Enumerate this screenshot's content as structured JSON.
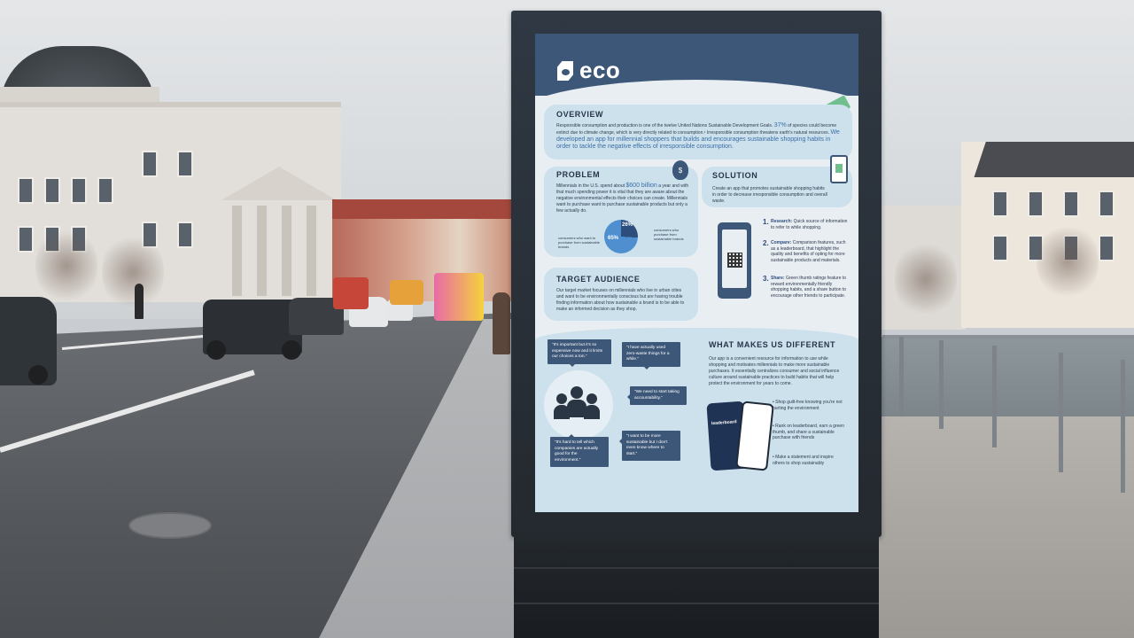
{
  "poster": {
    "logo": "eco",
    "overview": {
      "title": "OVERVIEW",
      "text_a": "Responsible consumption and production is one of the twelve United Nations Sustainable Development Goals.",
      "highlight_a": "37%",
      "text_b": "of species could become extinct due to climate change, which is very directly related to consumption.¹ Irresponsible consumption threatens earth's natural resources.",
      "highlight_b": "We developed an app for millennial shoppers that builds and encourages sustainable shopping habits in order to tackle the negative effects of irresponsible consumption."
    },
    "problem": {
      "title": "PROBLEM",
      "text_a": "Millennials in the U.S. spend about",
      "highlight": "$600 billion",
      "text_b": "a year and with that much spending power it is vital that they are aware about the negative environmental effects their choices can create. Millennials want to purchase want to purchase sustainable products but only a few actually do.",
      "pie_small": "26%",
      "pie_large": "65%",
      "note_left": "consumers who want to purchase from sustainable brands",
      "note_right": "consumers who purchase from sustainable brands"
    },
    "solution": {
      "title": "SOLUTION",
      "text": "Create an app that promotes sustainable shopping habits in order to decrease irresponsible consumption and overall waste.",
      "items": [
        {
          "num": "1.",
          "label": "Research:",
          "text": "Quick source of information to refer to while shopping."
        },
        {
          "num": "2.",
          "label": "Compare:",
          "text": "Comparison features, such as a leaderboard, that highlight the quality and benefits of opting for more sustainable products and materials."
        },
        {
          "num": "3.",
          "label": "Share:",
          "text": "Green thumb ratings feature to reward environmentally friendly shopping habits, and a share button to encourage other friends to participate."
        }
      ]
    },
    "audience": {
      "title": "TARGET AUDIENCE",
      "text": "Our target market focuses on millennials who live in urban cities and want to be environmentally conscious but are having trouble finding information about how sustainable a brand is to be able to make an informed decision as they shop."
    },
    "quotes": [
      "“It's important but it's so expensive now and it limits our choices a ton.”",
      "“I have actually used zero-waste things for a while.”",
      "“We need to start taking accountability.”",
      "“It's hard to tell which companies are actually good for the environment.”",
      "“I want to be more sustainable but I don't even know where to start.”"
    ],
    "different": {
      "title": "WHAT MAKES US DIFFERENT",
      "text": "Our app is a convenient resource for information to use while shopping and motivates millennials to make more sustainable purchases. It essentially centralizes consumer and social influence culture around sustainable practices to build habits that will help protect the environment for years to come.",
      "bullets": [
        "Shop guilt-free knowing you're not hurting the environment",
        "Rank on leaderboard, earn a green thumb, and share a sustainable purchase with friends",
        "Make a statement and inspire others to shop sustainably"
      ],
      "phone_label": "leaderboard"
    }
  },
  "colors": {
    "poster_navy": "#3d5779",
    "poster_panel": "#cde1ec",
    "accent_blue": "#3a6ea8",
    "accent_green": "#6fbf8f"
  }
}
